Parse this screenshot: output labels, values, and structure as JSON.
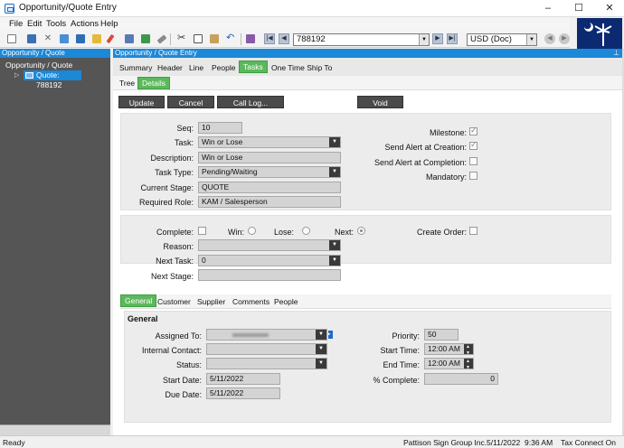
{
  "window": {
    "title": "Opportunity/Quote Entry",
    "minimize": "–",
    "maximize": "☐",
    "close": "✕"
  },
  "menu": [
    "File",
    "Edit",
    "Tools",
    "Actions",
    "Help"
  ],
  "toolbar": {
    "record": "788192",
    "currency": "USD (Doc)"
  },
  "tree": {
    "header": "Opportunity / Quote",
    "root": "Opportunity / Quote",
    "child": "Quote: 788192"
  },
  "main": {
    "header": "Opportunity / Quote Entry",
    "tabs": [
      "Summary",
      "Header",
      "Line",
      "People",
      "Tasks",
      "One Time Ship To"
    ],
    "active_tab": "Tasks",
    "subtabs": [
      "Tree",
      "Details"
    ],
    "active_subtab": "Details",
    "buttons": {
      "update": "Update",
      "cancel": "Cancel",
      "call_log": "Call Log...",
      "void": "Void"
    }
  },
  "task": {
    "seq_label": "Seq:",
    "seq": "10",
    "task_label": "Task:",
    "task": "Win or Lose",
    "description_label": "Description:",
    "description": "Win or Lose",
    "task_type_label": "Task Type:",
    "task_type": "Pending/Waiting",
    "current_stage_label": "Current Stage:",
    "current_stage": "QUOTE",
    "required_role_label": "Required Role:",
    "required_role": "KAM / Salesperson",
    "milestone_label": "Milestone:",
    "alert_creation_label": "Send Alert at Creation:",
    "alert_completion_label": "Send Alert at Completion:",
    "mandatory_label": "Mandatory:"
  },
  "completion": {
    "complete_label": "Complete:",
    "win_label": "Win:",
    "lose_label": "Lose:",
    "next_label": "Next:",
    "create_order_label": "Create Order:",
    "reason_label": "Reason:",
    "reason": "",
    "next_task_label": "Next Task:",
    "next_task": "0",
    "next_stage_label": "Next Stage:",
    "next_stage": ""
  },
  "bottom_tabs": [
    "General",
    "Customer",
    "Supplier",
    "Comments",
    "People"
  ],
  "active_bottom_tab": "General",
  "general": {
    "title": "General",
    "assigned_to_label": "Assigned To:",
    "internal_contact_label": "Internal Contact:",
    "internal_contact": "",
    "status_label": "Status:",
    "status": "",
    "start_date_label": "Start Date:",
    "start_date": "5/11/2022",
    "due_date_label": "Due Date:",
    "due_date": "5/11/2022",
    "priority_label": "Priority:",
    "priority": "50",
    "start_time_label": "Start Time:",
    "start_time": "12:00 AM",
    "end_time_label": "End Time:",
    "end_time": "12:00 AM",
    "percent_complete_label": "% Complete:",
    "percent_complete": "0"
  },
  "status_bar": {
    "state": "Ready",
    "company": "Pattison Sign Group Inc.",
    "date": "5/11/2022",
    "time": "9:36 AM",
    "tax": "Tax Connect On"
  }
}
